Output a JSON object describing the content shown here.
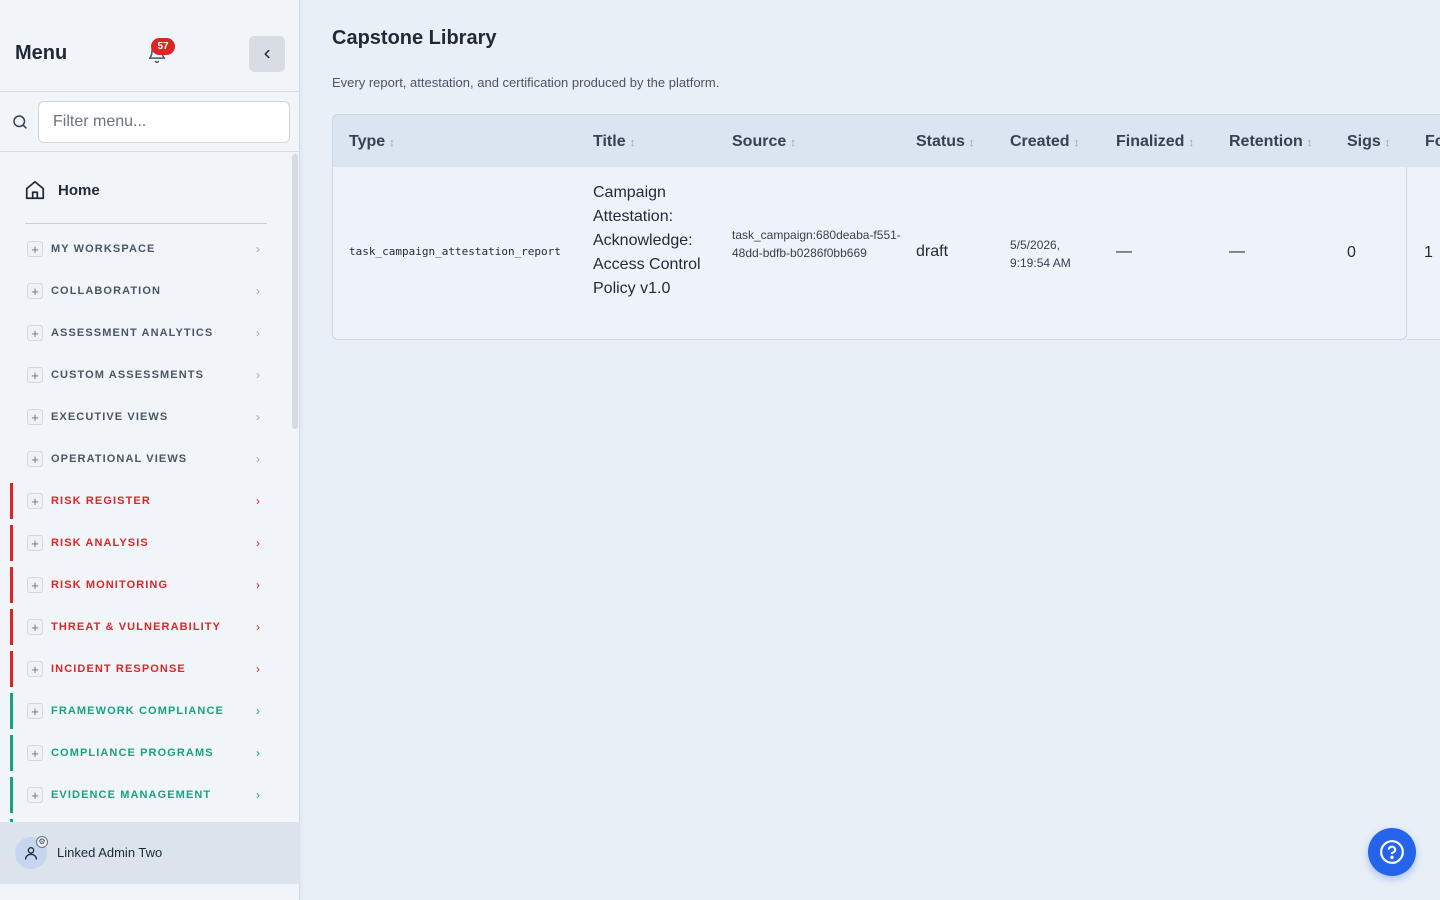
{
  "sidebar": {
    "title": "Menu",
    "notification_count": "57",
    "filter_placeholder": "Filter menu...",
    "home_label": "Home",
    "groups": [
      {
        "label": "MY WORKSPACE",
        "color": "#4b5563",
        "accent": ""
      },
      {
        "label": "COLLABORATION",
        "color": "#4b5563",
        "accent": ""
      },
      {
        "label": "ASSESSMENT ANALYTICS",
        "color": "#4b5563",
        "accent": ""
      },
      {
        "label": "CUSTOM ASSESSMENTS",
        "color": "#4b5563",
        "accent": ""
      },
      {
        "label": "EXECUTIVE VIEWS",
        "color": "#4b5563",
        "accent": ""
      },
      {
        "label": "OPERATIONAL VIEWS",
        "color": "#4b5563",
        "accent": ""
      },
      {
        "label": "RISK REGISTER",
        "color": "#dc2626",
        "accent": "#dc2626"
      },
      {
        "label": "RISK ANALYSIS",
        "color": "#dc2626",
        "accent": "#dc2626"
      },
      {
        "label": "RISK MONITORING",
        "color": "#dc2626",
        "accent": "#dc2626"
      },
      {
        "label": "THREAT & VULNERABILITY",
        "color": "#dc2626",
        "accent": "#dc2626"
      },
      {
        "label": "INCIDENT RESPONSE",
        "color": "#dc2626",
        "accent": "#dc2626"
      },
      {
        "label": "FRAMEWORK COMPLIANCE",
        "color": "#16a37f",
        "accent": "#16a37f"
      },
      {
        "label": "COMPLIANCE PROGRAMS",
        "color": "#16a37f",
        "accent": "#16a37f"
      },
      {
        "label": "EVIDENCE MANAGEMENT",
        "color": "#16a37f",
        "accent": "#16a37f"
      },
      {
        "label": "",
        "color": "#16a37f",
        "accent": "#16a37f"
      }
    ],
    "user_name": "Linked Admin Two"
  },
  "main": {
    "title": "Capstone Library",
    "subtitle": "Every report, attestation, and certification produced by the platform.",
    "columns": [
      "Type",
      "Title",
      "Source",
      "Status",
      "Created",
      "Finalized",
      "Retention",
      "Sigs",
      "Fo"
    ],
    "rows": [
      {
        "type": "task_campaign_attestation_report",
        "title": "Campaign Attestation: Acknowledge: Access Control Policy v1.0",
        "source": "task_campaign:680deaba-f551-48dd-bdfb-b0286f0bb669",
        "status": "draft",
        "created": "5/5/2026, 9:19:54 AM",
        "finalized": "—",
        "retention": "—",
        "sigs": "0",
        "extra": "1"
      }
    ]
  },
  "icons": {
    "bell": "bell-icon",
    "collapse": "chevron-left-icon",
    "search": "search-icon",
    "home": "home-icon",
    "expand": "plus-icon",
    "chevron": "chevron-right-icon",
    "user": "user-icon",
    "help": "help-circle-icon"
  },
  "colors": {
    "risk_accent": "#dc2626",
    "compliance_accent": "#16a37f",
    "primary": "#2563eb"
  }
}
